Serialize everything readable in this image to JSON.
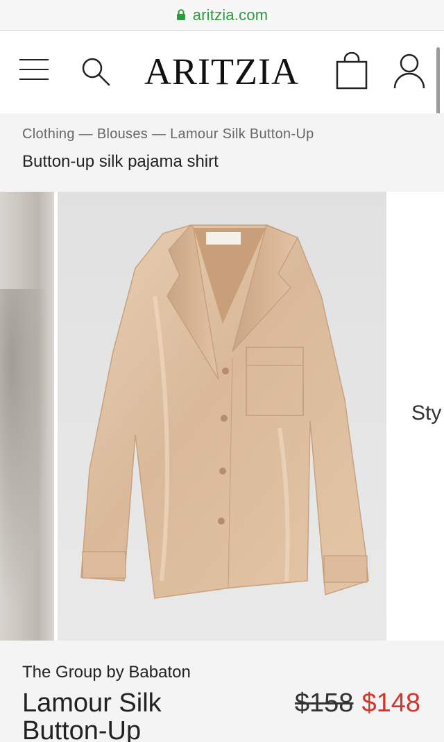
{
  "browser": {
    "domain": "aritzia.com"
  },
  "header": {
    "logo": "ARITZIA"
  },
  "breadcrumb": {
    "items": [
      "Clothing",
      "Blouses",
      "Lamour Silk Button-Up"
    ],
    "separator": "—"
  },
  "page": {
    "subtitle": "Button-up silk pajama shirt"
  },
  "gallery": {
    "next_slide_partial_text": "Sty"
  },
  "product": {
    "brand": "The Group by Babaton",
    "name": "Lamour Silk Button-Up",
    "original_price": "$158",
    "sale_price": "$148"
  },
  "colors": {
    "secure": "#2d9a3b",
    "sale": "#d9342b",
    "product": "#ddbf9f"
  }
}
